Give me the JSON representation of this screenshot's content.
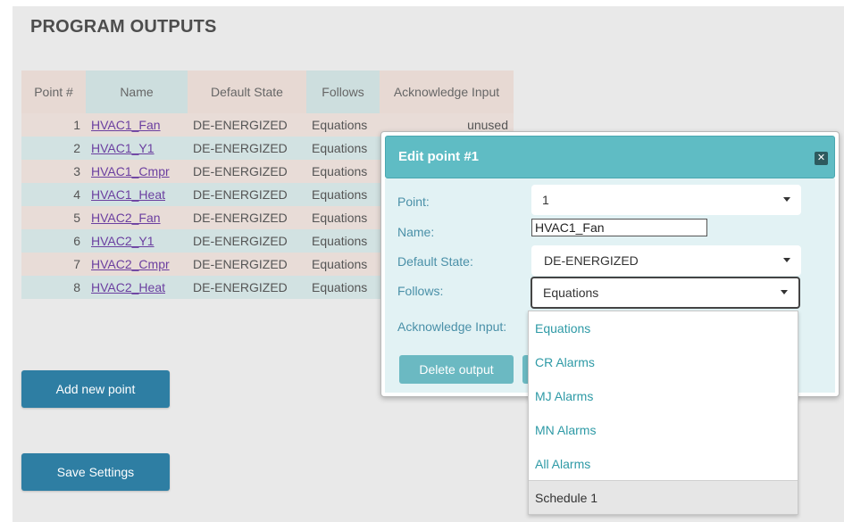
{
  "page": {
    "title": "PROGRAM OUTPUTS"
  },
  "table": {
    "headers": [
      "Point #",
      "Name",
      "Default State",
      "Follows",
      "Acknowledge Input"
    ],
    "rows": [
      {
        "num": "1",
        "name": "HVAC1_Fan",
        "state": "DE-ENERGIZED",
        "follows": "Equations",
        "ack": "unused"
      },
      {
        "num": "2",
        "name": "HVAC1_Y1",
        "state": "DE-ENERGIZED",
        "follows": "Equations",
        "ack": ""
      },
      {
        "num": "3",
        "name": "HVAC1_Cmpr",
        "state": "DE-ENERGIZED",
        "follows": "Equations",
        "ack": ""
      },
      {
        "num": "4",
        "name": "HVAC1_Heat",
        "state": "DE-ENERGIZED",
        "follows": "Equations",
        "ack": ""
      },
      {
        "num": "5",
        "name": "HVAC2_Fan",
        "state": "DE-ENERGIZED",
        "follows": "Equations",
        "ack": ""
      },
      {
        "num": "6",
        "name": "HVAC2_Y1",
        "state": "DE-ENERGIZED",
        "follows": "Equations",
        "ack": ""
      },
      {
        "num": "7",
        "name": "HVAC2_Cmpr",
        "state": "DE-ENERGIZED",
        "follows": "Equations",
        "ack": ""
      },
      {
        "num": "8",
        "name": "HVAC2_Heat",
        "state": "DE-ENERGIZED",
        "follows": "Equations",
        "ack": ""
      }
    ]
  },
  "buttons": {
    "add_point": "Add new point",
    "save_settings": "Save Settings"
  },
  "dialog": {
    "title": "Edit point #1",
    "close_icon": "close-x-icon",
    "labels": {
      "point": "Point:",
      "name": "Name:",
      "default_state": "Default State:",
      "follows": "Follows:",
      "acknowledge_input": "Acknowledge Input:"
    },
    "values": {
      "point": "1",
      "name": "HVAC1_Fan",
      "default_state": "DE-ENERGIZED",
      "follows": "Equations"
    },
    "delete_button": "Delete output"
  },
  "dropdown": {
    "options": [
      "Equations",
      "CR Alarms",
      "MJ Alarms",
      "MN Alarms",
      "All Alarms",
      "Schedule 1"
    ],
    "highlighted": "Schedule 1"
  },
  "colors": {
    "accent": "#2e7ea3",
    "dialog_header": "#5fbcc4",
    "link": "#6b3fa0"
  }
}
